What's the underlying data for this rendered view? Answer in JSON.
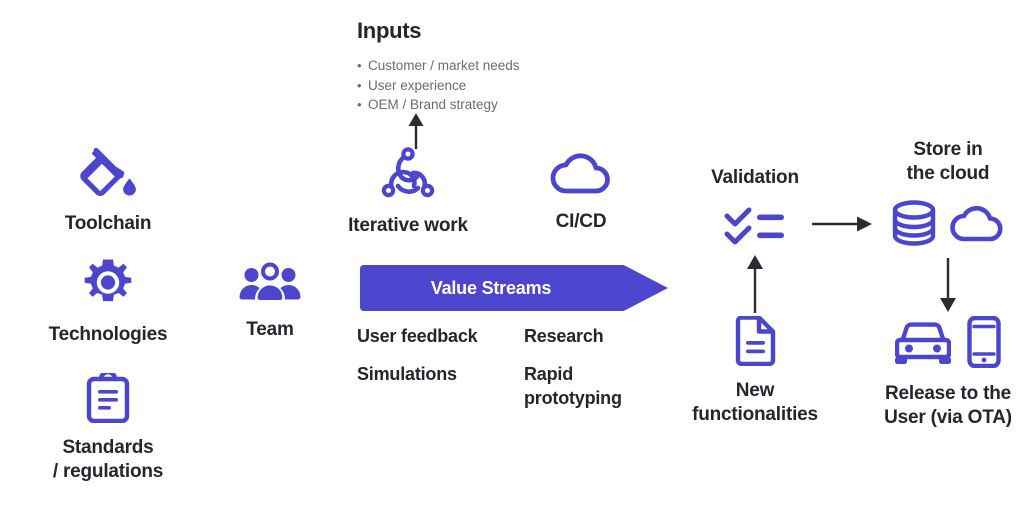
{
  "theme": {
    "accent": "#4c46cf",
    "text": "#25252e",
    "muted": "#6b6b72",
    "arrow": "#2b2b33",
    "background": "#ffffff"
  },
  "inputs": {
    "title": "Inputs",
    "bullets": [
      "Customer / market needs",
      "User experience",
      "OEM / Brand strategy"
    ]
  },
  "foundations": [
    {
      "label": "Toolchain",
      "icon": "paint-bucket-icon"
    },
    {
      "label": "Technologies",
      "icon": "gear-icon"
    },
    {
      "label": "Standards\n/ regulations",
      "icon": "clipboard-icon"
    }
  ],
  "team": {
    "label": "Team",
    "icon": "people-group-icon"
  },
  "practices": [
    {
      "label": "Iterative work",
      "icon": "iterative-cycle-icon"
    },
    {
      "label": "CI/CD",
      "icon": "cloud-icon"
    }
  ],
  "value_stream": {
    "label": "Value Streams",
    "items_left": [
      "User feedback",
      "Simulations"
    ],
    "items_right": [
      "Research",
      "Rapid\nprototyping"
    ]
  },
  "validation": {
    "label": "Validation",
    "icon": "checklist-icon"
  },
  "new_functionalities": {
    "label": "New\nfunctionalities",
    "icon": "document-icon"
  },
  "store_cloud": {
    "label": "Store in\nthe cloud",
    "icons": [
      "database-icon",
      "cloud-outline-icon"
    ]
  },
  "release": {
    "label": "Release to the\nUser (via OTA)",
    "icons": [
      "car-icon",
      "smartphone-icon"
    ]
  },
  "connectors": [
    {
      "name": "arrow-up-to-inputs",
      "direction": "up"
    },
    {
      "name": "arrow-validation-to-cloud",
      "direction": "right"
    },
    {
      "name": "arrow-functionalities-to-validation",
      "direction": "up"
    },
    {
      "name": "arrow-cloud-to-release",
      "direction": "down"
    }
  ]
}
